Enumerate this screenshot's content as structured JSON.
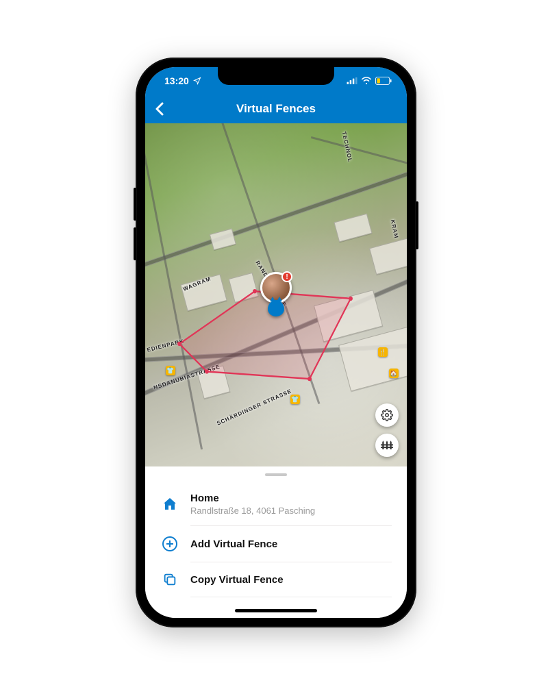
{
  "status_bar": {
    "time": "13:20"
  },
  "header": {
    "title": "Virtual Fences"
  },
  "map": {
    "street_labels": {
      "wagram": "WAGRAM",
      "randlstrasse": "RANDLSTRASSE",
      "schardinger": "SCHÄRDINGER STRASSE",
      "nsdanubia": "NSDANUBIASTRASSE",
      "edienpark": "EDIENPARK",
      "technol": "TECHNOL",
      "kram": "KRAM"
    },
    "avatar_alert": "!"
  },
  "sheet": {
    "home": {
      "title": "Home",
      "address": "Randlstraße 18, 4061 Pasching"
    },
    "add": {
      "label": "Add Virtual Fence"
    },
    "copy": {
      "label": "Copy Virtual Fence"
    }
  }
}
